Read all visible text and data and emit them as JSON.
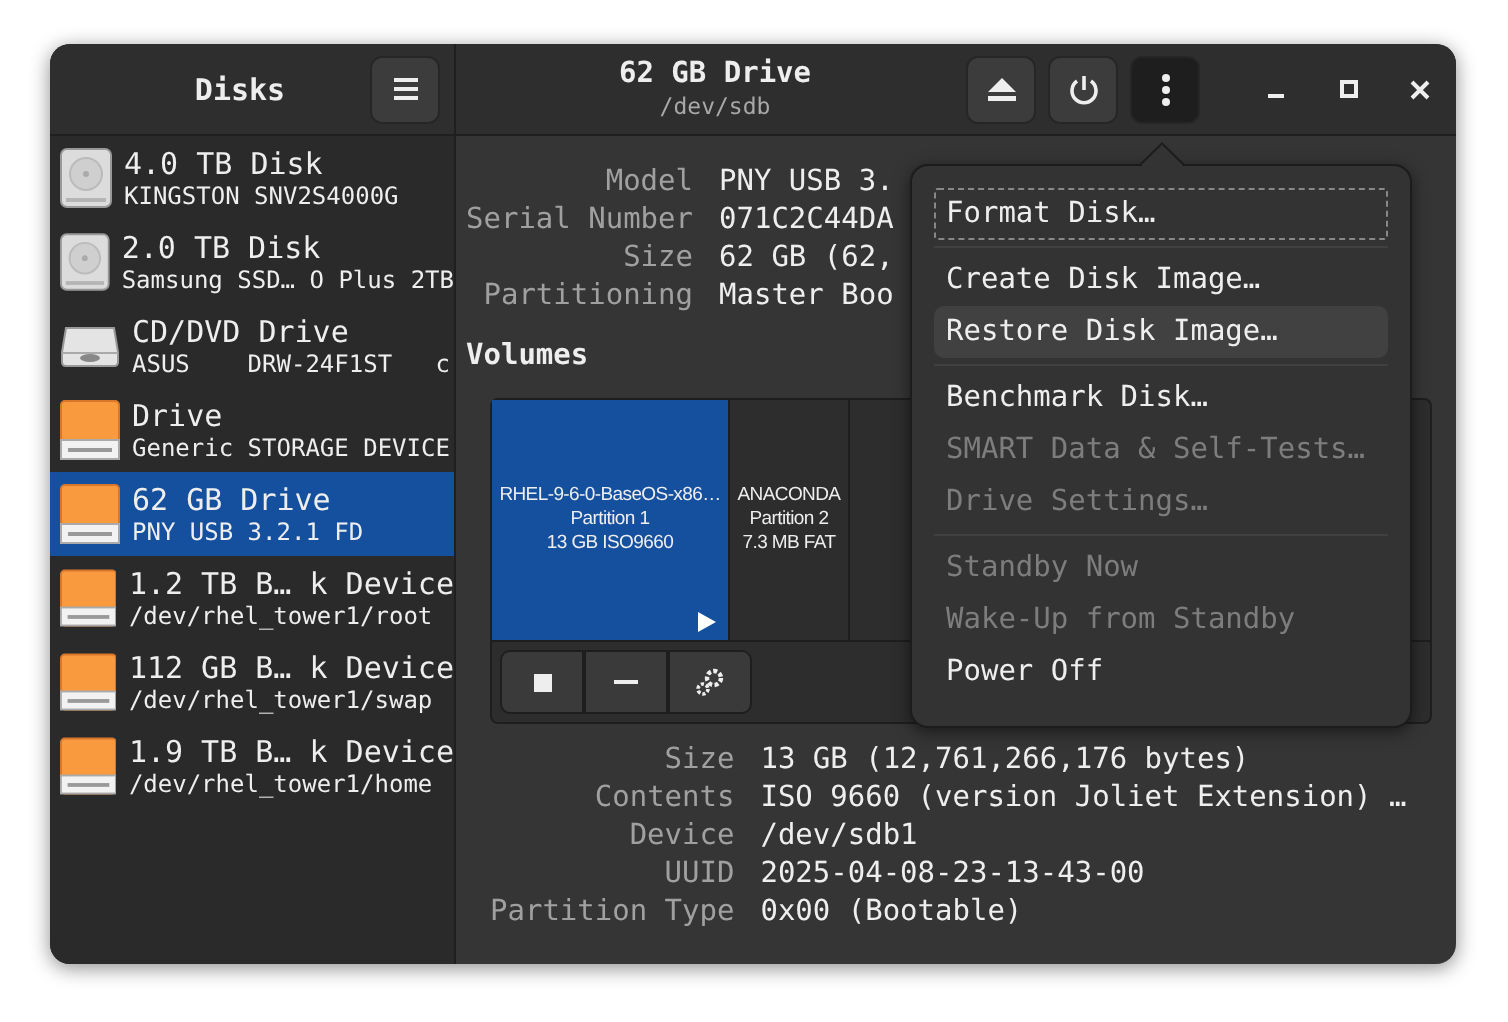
{
  "sidebar": {
    "title": "Disks",
    "items": [
      {
        "kind": "hdd",
        "title": "4.0 TB Disk",
        "subtitle": "KINGSTON SNV2S4000G",
        "selected": false
      },
      {
        "kind": "hdd",
        "title": "2.0 TB Disk",
        "subtitle": "Samsung SSD… O Plus 2TB",
        "selected": false
      },
      {
        "kind": "optical",
        "title": "CD/DVD Drive",
        "subtitle": "ASUS    DRW-24F1ST   c",
        "selected": false
      },
      {
        "kind": "drive",
        "title": "Drive",
        "subtitle": "Generic STORAGE DEVICE",
        "selected": false
      },
      {
        "kind": "drive",
        "title": "62 GB Drive",
        "subtitle": "PNY USB 3.2.1 FD",
        "selected": true
      },
      {
        "kind": "drive",
        "title": "1.2 TB B… k Device",
        "subtitle": "/dev/rhel_tower1/root",
        "selected": false
      },
      {
        "kind": "drive",
        "title": "112 GB B… k Device",
        "subtitle": "/dev/rhel_tower1/swap",
        "selected": false
      },
      {
        "kind": "drive",
        "title": "1.9 TB B… k Device",
        "subtitle": "/dev/rhel_tower1/home",
        "selected": false
      }
    ]
  },
  "header": {
    "title": "62 GB Drive",
    "subtitle": "/dev/sdb",
    "menu_open": true
  },
  "drive_details": [
    {
      "label": "Model",
      "value": "PNY USB 3."
    },
    {
      "label": "Serial Number",
      "value": "071C2C44DA"
    },
    {
      "label": "Size",
      "value": "62 GB (62,"
    },
    {
      "label": "Partitioning",
      "value": "Master Boo"
    }
  ],
  "volumes": {
    "title": "Volumes",
    "partitions": [
      {
        "lines": [
          "RHEL-9-6-0-BaseOS-x86…",
          "Partition 1",
          "13 GB ISO9660"
        ],
        "selected": true,
        "mounted": true
      },
      {
        "lines": [
          "ANACONDA",
          "Partition 2",
          "7.3 MB FAT"
        ],
        "selected": false,
        "mounted": false
      }
    ]
  },
  "volume_details": [
    {
      "label": "Size",
      "value": "13 GB (12,761,266,176 bytes)"
    },
    {
      "label": "Contents",
      "value": "ISO 9660 (version Joliet Extension) …"
    },
    {
      "label": "Device",
      "value": "/dev/sdb1"
    },
    {
      "label": "UUID",
      "value": "2025-04-08-23-13-43-00"
    },
    {
      "label": "Partition Type",
      "value": "0x00 (Bootable)"
    }
  ],
  "menu": {
    "sections": [
      [
        {
          "label": "Format Disk…",
          "disabled": false,
          "selected": false,
          "focused": true
        }
      ],
      [
        {
          "label": "Create Disk Image…",
          "disabled": false,
          "selected": false,
          "focused": false
        },
        {
          "label": "Restore Disk Image…",
          "disabled": false,
          "selected": true,
          "focused": false
        }
      ],
      [
        {
          "label": "Benchmark Disk…",
          "disabled": false,
          "selected": false,
          "focused": false
        },
        {
          "label": "SMART Data & Self-Tests…",
          "disabled": true,
          "selected": false,
          "focused": false
        },
        {
          "label": "Drive Settings…",
          "disabled": true,
          "selected": false,
          "focused": false
        }
      ],
      [
        {
          "label": "Standby Now",
          "disabled": true,
          "selected": false,
          "focused": false
        },
        {
          "label": "Wake-Up from Standby",
          "disabled": true,
          "selected": false,
          "focused": false
        },
        {
          "label": "Power Off",
          "disabled": false,
          "selected": false,
          "focused": false
        }
      ]
    ]
  }
}
